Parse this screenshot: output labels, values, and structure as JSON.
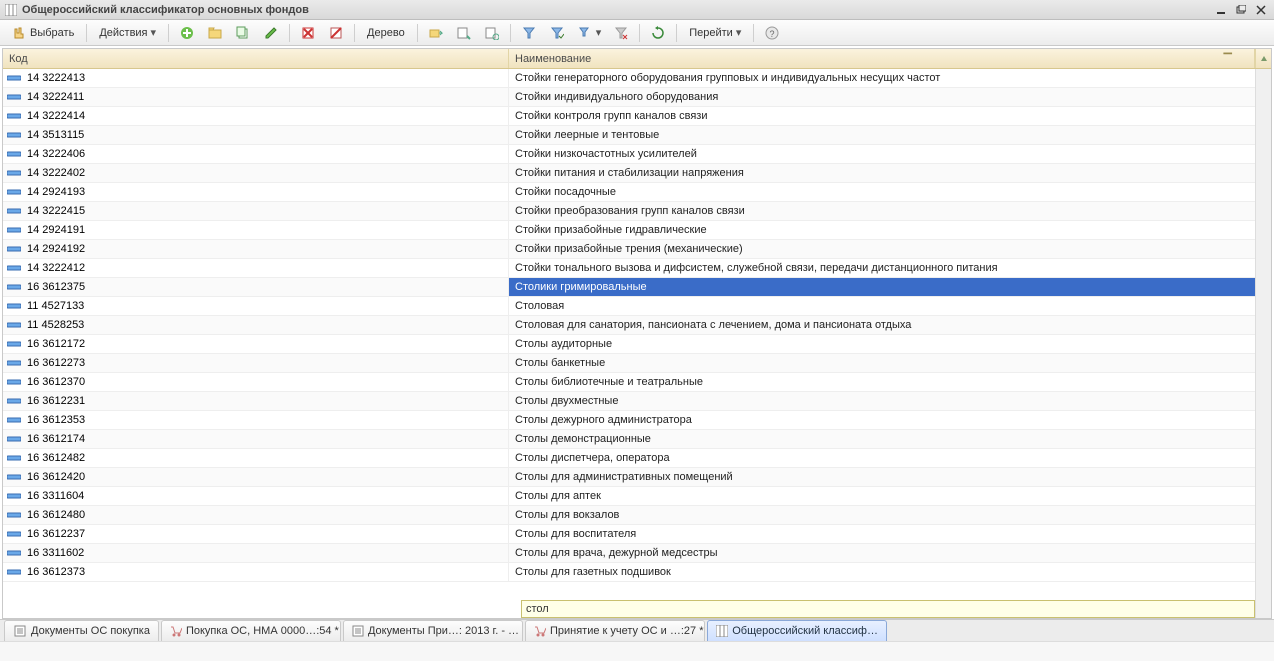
{
  "window": {
    "title": "Общероссийский классификатор основных фондов"
  },
  "toolbar": {
    "select_label": "Выбрать",
    "actions_label": "Действия",
    "tree_label": "Дерево",
    "go_label": "Перейти"
  },
  "columns": {
    "code": "Код",
    "name": "Наименование"
  },
  "search_value": "стол",
  "selected_index": 11,
  "rows": [
    {
      "code": "14 3222413",
      "name": "Стойки генераторного оборудования групповых и индивидуальных несущих частот"
    },
    {
      "code": "14 3222411",
      "name": "Стойки индивидуального оборудования"
    },
    {
      "code": "14 3222414",
      "name": "Стойки контроля групп каналов связи"
    },
    {
      "code": "14 3513115",
      "name": "Стойки леерные и тентовые"
    },
    {
      "code": "14 3222406",
      "name": "Стойки низкочастотных усилителей"
    },
    {
      "code": "14 3222402",
      "name": "Стойки питания и стабилизации напряжения"
    },
    {
      "code": "14 2924193",
      "name": "Стойки посадочные"
    },
    {
      "code": "14 3222415",
      "name": "Стойки преобразования групп каналов связи"
    },
    {
      "code": "14 2924191",
      "name": "Стойки призабойные гидравлические"
    },
    {
      "code": "14 2924192",
      "name": "Стойки призабойные трения (механические)"
    },
    {
      "code": "14 3222412",
      "name": "Стойки тонального вызова и дифсистем, служебной связи, передачи дистанционного питания"
    },
    {
      "code": "16 3612375",
      "name": "Столики гримировальные"
    },
    {
      "code": "11 4527133",
      "name": "Столовая"
    },
    {
      "code": "11 4528253",
      "name": "Столовая для санатория, пансионата с лечением, дома и пансионата отдыха"
    },
    {
      "code": "16 3612172",
      "name": "Столы аудиторные"
    },
    {
      "code": "16 3612273",
      "name": "Столы банкетные"
    },
    {
      "code": "16 3612370",
      "name": "Столы библиотечные и театральные"
    },
    {
      "code": "16 3612231",
      "name": "Столы двухместные"
    },
    {
      "code": "16 3612353",
      "name": "Столы дежурного администратора"
    },
    {
      "code": "16 3612174",
      "name": "Столы демонстрационные"
    },
    {
      "code": "16 3612482",
      "name": "Столы диспетчера, оператора"
    },
    {
      "code": "16 3612420",
      "name": "Столы для административных помещений"
    },
    {
      "code": "16 3311604",
      "name": "Столы для аптек"
    },
    {
      "code": "16 3612480",
      "name": "Столы для вокзалов"
    },
    {
      "code": "16 3612237",
      "name": "Столы для воспитателя"
    },
    {
      "code": "16 3311602",
      "name": "Столы для врача, дежурной медсестры"
    },
    {
      "code": "16 3612373",
      "name": "Столы для газетных подшивок"
    }
  ],
  "tabs": [
    {
      "label": "Документы ОС покупка",
      "icon": "doc"
    },
    {
      "label": "Покупка ОС, НМА 0000…:54 *",
      "icon": "cart"
    },
    {
      "label": "Документы При…: 2013 г. - …",
      "icon": "doc"
    },
    {
      "label": "Принятие к учету ОС и …:27 *",
      "icon": "cart"
    },
    {
      "label": "Общероссийский классиф…",
      "icon": "grid",
      "active": true
    }
  ]
}
